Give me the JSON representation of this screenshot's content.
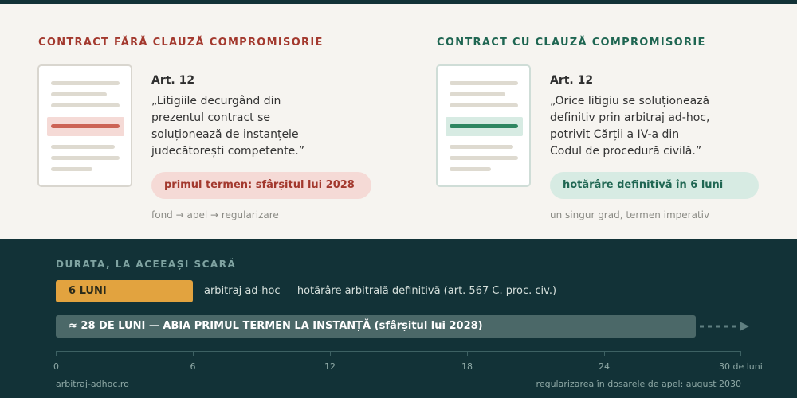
{
  "left": {
    "title": "CONTRACT FĂRĂ CLAUZĂ COMPROMISORIE",
    "article": "Art. 12",
    "quote": "„Litigiile decurgând din\nprezentul contract se\nsoluționează de instanțele\njudecătorești competente.”",
    "pill": "primul termen: sfârșitul lui 2028",
    "note": "fond → apel → regularizare",
    "accent": "#a3392e"
  },
  "right": {
    "title": "CONTRACT CU CLAUZĂ COMPROMISORIE",
    "article": "Art. 12",
    "quote": "„Orice litigiu se soluționează\ndefinitiv prin arbitraj ad-hoc,\npotrivit Cărții a IV-a din\nCodul de procedură civilă.”",
    "pill": "hotărâre definitivă în 6 luni",
    "note": "un singur grad, termen imperativ",
    "accent": "#1f6652"
  },
  "timeline": {
    "title": "DURATA, LA ACEEAȘI SCARĂ",
    "unit_max": 30,
    "bars": [
      {
        "label": "6 LUNI",
        "months": 6,
        "color": "#e2a33f",
        "description": "arbitraj ad-hoc — hotărâre arbitrală definitivă (art. 567 C. proc. civ.)"
      },
      {
        "label": "≈ 28 DE LUNI — ABIA PRIMUL TERMEN LA INSTANȚĂ (sfârșitul lui 2028)",
        "months": 28,
        "color": "#4b6868",
        "continues": true
      }
    ],
    "ticks": [
      "0",
      "6",
      "12",
      "18",
      "24",
      "30 de luni"
    ]
  },
  "footer": {
    "source": "arbitraj-adhoc.ro",
    "note": "regularizarea în dosarele de apel: august 2030"
  }
}
